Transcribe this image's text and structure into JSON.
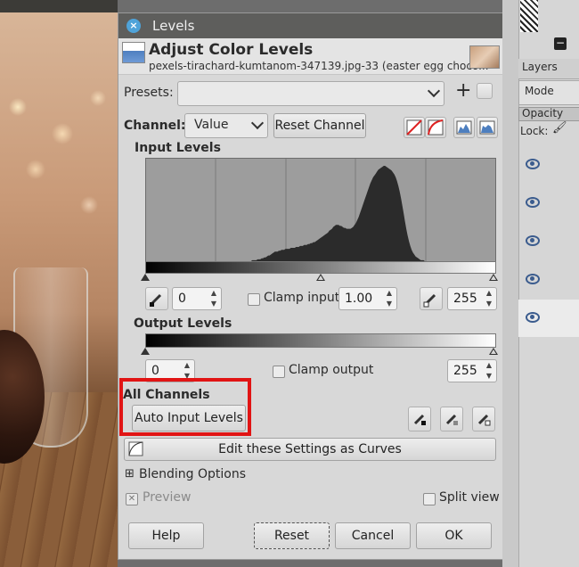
{
  "window": {
    "title": "Levels"
  },
  "header": {
    "title": "Adjust Color Levels",
    "subtitle": "pexels-tirachard-kumtanom-347139.jpg-33 (easter egg choco..."
  },
  "presets": {
    "label": "Presets:",
    "value": ""
  },
  "channel": {
    "label": "Channel:",
    "value": "Value",
    "reset_label": "Reset Channel"
  },
  "input_levels": {
    "heading": "Input Levels",
    "low": "0",
    "gamma": "1.00",
    "high": "255",
    "clamp_label": "Clamp input"
  },
  "output_levels": {
    "heading": "Output Levels",
    "low": "0",
    "high": "255",
    "clamp_label": "Clamp output"
  },
  "all_channels": {
    "heading": "All Channels",
    "auto_label": "Auto Input Levels"
  },
  "curves": {
    "label": "Edit these Settings as Curves"
  },
  "blending": {
    "label": "Blending Options"
  },
  "preview": {
    "label": "Preview",
    "checked": true
  },
  "split_view": {
    "label": "Split view",
    "checked": false
  },
  "buttons": {
    "help": "Help",
    "reset": "Reset",
    "cancel": "Cancel",
    "ok": "OK"
  },
  "right_panel": {
    "tab_label": "Layers",
    "mode_label": "Mode",
    "opacity_label": "Opacity",
    "lock_label": "Lock:"
  },
  "colors": {
    "highlight": "#e11414",
    "accent": "#4fa3d9"
  },
  "histogram_values": [
    0,
    0,
    0,
    0,
    0,
    0,
    0,
    0,
    0,
    0,
    0,
    0,
    0,
    0,
    0,
    0,
    0,
    0,
    0,
    0,
    0,
    0,
    0,
    0,
    0,
    0,
    0,
    0,
    0,
    0,
    0,
    0,
    0,
    0,
    0,
    0,
    0,
    0,
    0,
    0,
    0,
    0,
    0,
    0,
    0,
    0,
    0,
    0,
    0,
    0,
    0,
    0,
    0,
    0,
    0,
    0,
    0,
    0,
    0,
    0,
    0,
    0,
    0,
    0,
    0,
    0,
    0,
    0,
    0,
    0,
    0,
    0,
    0,
    0,
    0,
    0,
    0,
    0,
    0,
    0,
    1,
    1,
    1,
    1,
    2,
    2,
    2,
    3,
    3,
    4,
    4,
    5,
    6,
    6,
    7,
    8,
    9,
    10,
    10,
    10,
    11,
    11,
    12,
    12,
    12,
    13,
    13,
    13,
    13,
    14,
    14,
    14,
    14,
    15,
    15,
    15,
    16,
    16,
    16,
    17,
    17,
    17,
    18,
    18,
    19,
    19,
    20,
    20,
    21,
    22,
    23,
    24,
    25,
    26,
    27,
    28,
    29,
    30,
    32,
    33,
    34,
    36,
    37,
    38,
    38,
    38,
    37,
    37,
    36,
    35,
    35,
    34,
    34,
    34,
    34,
    35,
    36,
    38,
    40,
    43,
    46,
    50,
    54,
    58,
    62,
    66,
    70,
    74,
    78,
    82,
    85,
    88,
    90,
    92,
    94,
    96,
    97,
    98,
    99,
    100,
    100,
    99,
    98,
    97,
    96,
    95,
    93,
    91,
    88,
    84,
    79,
    73,
    66,
    58,
    50,
    42,
    34,
    27,
    21,
    16,
    12,
    9,
    7,
    5,
    4,
    3,
    2,
    1,
    1,
    1,
    0,
    0,
    0,
    0,
    0,
    0,
    0,
    0,
    0,
    0,
    0,
    0,
    0,
    0,
    0,
    0,
    0,
    0,
    0,
    0,
    0,
    0,
    0,
    0,
    0,
    0,
    0,
    0,
    0,
    0,
    0,
    0,
    0,
    0,
    0,
    0,
    0,
    0,
    0,
    0,
    0,
    0,
    0,
    0,
    0,
    0,
    0,
    0,
    0,
    0,
    0,
    0,
    0,
    0
  ]
}
